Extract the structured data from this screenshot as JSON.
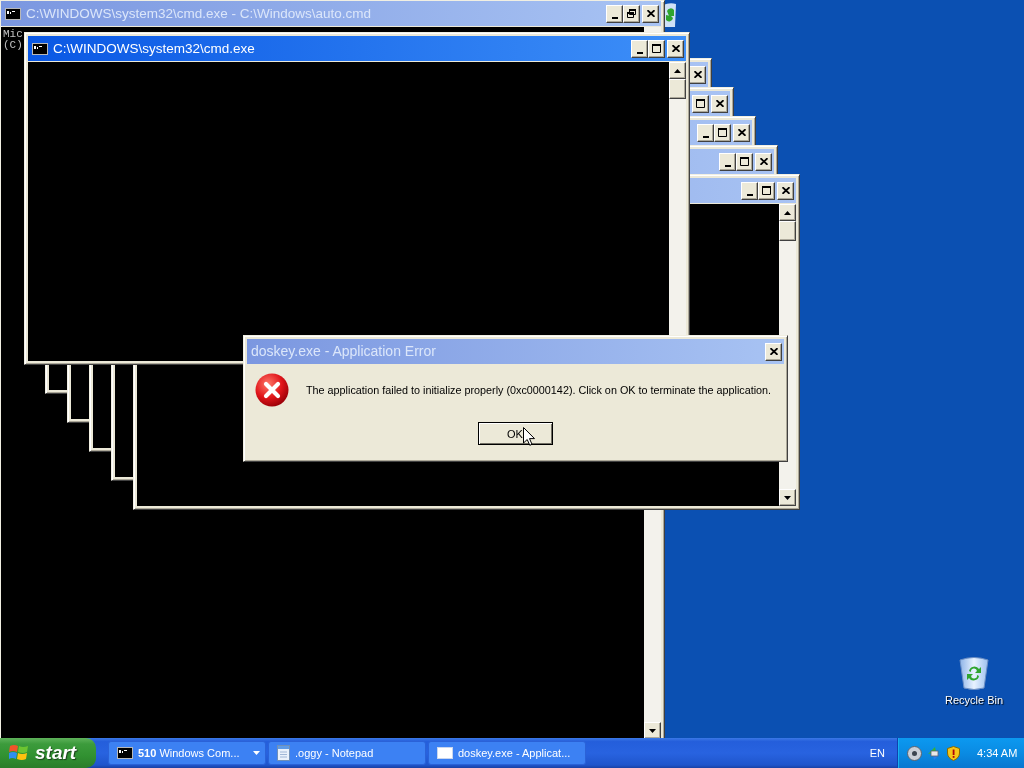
{
  "desktop_icons": [
    {
      "kind": "recycle_bin",
      "label": "Recycle Bin"
    }
  ],
  "background_window": {
    "title": "C:\\WINDOWS\\system32\\cmd.exe - C:\\Windows\\auto.cmd",
    "active": false,
    "maximized": true,
    "title_buttons": [
      {
        "kind": "minimize"
      },
      {
        "kind": "maximize"
      },
      {
        "kind": "close"
      }
    ],
    "lines": [
      "Mic",
      "(C)"
    ]
  },
  "cascaded_windows": [
    {
      "active": false,
      "title_buttons": [
        {
          "kind": "close"
        }
      ]
    },
    {
      "active": false,
      "maximized": false,
      "title_buttons": [
        {
          "kind": "maximize"
        },
        {
          "kind": "close"
        }
      ]
    },
    {
      "active": false,
      "maximized": false,
      "title_buttons": [
        {
          "kind": "minimize"
        },
        {
          "kind": "maximize"
        },
        {
          "kind": "close"
        }
      ]
    },
    {
      "active": false,
      "maximized": false,
      "title_buttons": [
        {
          "kind": "minimize"
        },
        {
          "kind": "maximize"
        },
        {
          "kind": "close"
        }
      ]
    },
    {
      "active": false,
      "maximized": false,
      "title_buttons": [
        {
          "kind": "minimize"
        },
        {
          "kind": "maximize"
        },
        {
          "kind": "close"
        }
      ]
    }
  ],
  "front_window": {
    "title": "C:\\WINDOWS\\system32\\cmd.exe",
    "active": true,
    "maximized": false,
    "title_buttons": [
      {
        "kind": "minimize"
      },
      {
        "kind": "maximize"
      },
      {
        "kind": "close"
      }
    ]
  },
  "error_dialog": {
    "title": "doskey.exe - Application Error",
    "active": false,
    "title_buttons": [
      {
        "kind": "close"
      }
    ],
    "message": "The application failed to initialize properly (0xc0000142). Click on OK to terminate the application.",
    "buttons": [
      {
        "label": "OK",
        "default": true
      }
    ]
  },
  "taskbar": {
    "start_label": "start",
    "buttons": [
      {
        "kind": "console",
        "label": "**510** Windows Com...",
        "grouped": true,
        "selected": false
      },
      {
        "kind": "notepad",
        "label": ".oggy - Notepad",
        "selected": false
      },
      {
        "kind": "window",
        "label": "doskey.exe - Applicat...",
        "selected": false
      }
    ],
    "language": "EN",
    "clock": "4:34 AM"
  }
}
